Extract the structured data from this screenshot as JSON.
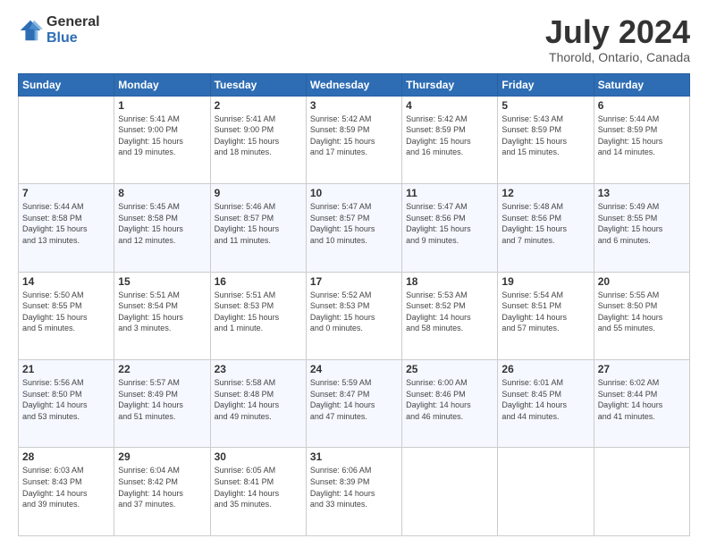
{
  "logo": {
    "general": "General",
    "blue": "Blue"
  },
  "header": {
    "month": "July 2024",
    "location": "Thorold, Ontario, Canada"
  },
  "days_of_week": [
    "Sunday",
    "Monday",
    "Tuesday",
    "Wednesday",
    "Thursday",
    "Friday",
    "Saturday"
  ],
  "weeks": [
    [
      {
        "day": "",
        "info": ""
      },
      {
        "day": "1",
        "info": "Sunrise: 5:41 AM\nSunset: 9:00 PM\nDaylight: 15 hours\nand 19 minutes."
      },
      {
        "day": "2",
        "info": "Sunrise: 5:41 AM\nSunset: 9:00 PM\nDaylight: 15 hours\nand 18 minutes."
      },
      {
        "day": "3",
        "info": "Sunrise: 5:42 AM\nSunset: 8:59 PM\nDaylight: 15 hours\nand 17 minutes."
      },
      {
        "day": "4",
        "info": "Sunrise: 5:42 AM\nSunset: 8:59 PM\nDaylight: 15 hours\nand 16 minutes."
      },
      {
        "day": "5",
        "info": "Sunrise: 5:43 AM\nSunset: 8:59 PM\nDaylight: 15 hours\nand 15 minutes."
      },
      {
        "day": "6",
        "info": "Sunrise: 5:44 AM\nSunset: 8:59 PM\nDaylight: 15 hours\nand 14 minutes."
      }
    ],
    [
      {
        "day": "7",
        "info": "Sunrise: 5:44 AM\nSunset: 8:58 PM\nDaylight: 15 hours\nand 13 minutes."
      },
      {
        "day": "8",
        "info": "Sunrise: 5:45 AM\nSunset: 8:58 PM\nDaylight: 15 hours\nand 12 minutes."
      },
      {
        "day": "9",
        "info": "Sunrise: 5:46 AM\nSunset: 8:57 PM\nDaylight: 15 hours\nand 11 minutes."
      },
      {
        "day": "10",
        "info": "Sunrise: 5:47 AM\nSunset: 8:57 PM\nDaylight: 15 hours\nand 10 minutes."
      },
      {
        "day": "11",
        "info": "Sunrise: 5:47 AM\nSunset: 8:56 PM\nDaylight: 15 hours\nand 9 minutes."
      },
      {
        "day": "12",
        "info": "Sunrise: 5:48 AM\nSunset: 8:56 PM\nDaylight: 15 hours\nand 7 minutes."
      },
      {
        "day": "13",
        "info": "Sunrise: 5:49 AM\nSunset: 8:55 PM\nDaylight: 15 hours\nand 6 minutes."
      }
    ],
    [
      {
        "day": "14",
        "info": "Sunrise: 5:50 AM\nSunset: 8:55 PM\nDaylight: 15 hours\nand 5 minutes."
      },
      {
        "day": "15",
        "info": "Sunrise: 5:51 AM\nSunset: 8:54 PM\nDaylight: 15 hours\nand 3 minutes."
      },
      {
        "day": "16",
        "info": "Sunrise: 5:51 AM\nSunset: 8:53 PM\nDaylight: 15 hours\nand 1 minute."
      },
      {
        "day": "17",
        "info": "Sunrise: 5:52 AM\nSunset: 8:53 PM\nDaylight: 15 hours\nand 0 minutes."
      },
      {
        "day": "18",
        "info": "Sunrise: 5:53 AM\nSunset: 8:52 PM\nDaylight: 14 hours\nand 58 minutes."
      },
      {
        "day": "19",
        "info": "Sunrise: 5:54 AM\nSunset: 8:51 PM\nDaylight: 14 hours\nand 57 minutes."
      },
      {
        "day": "20",
        "info": "Sunrise: 5:55 AM\nSunset: 8:50 PM\nDaylight: 14 hours\nand 55 minutes."
      }
    ],
    [
      {
        "day": "21",
        "info": "Sunrise: 5:56 AM\nSunset: 8:50 PM\nDaylight: 14 hours\nand 53 minutes."
      },
      {
        "day": "22",
        "info": "Sunrise: 5:57 AM\nSunset: 8:49 PM\nDaylight: 14 hours\nand 51 minutes."
      },
      {
        "day": "23",
        "info": "Sunrise: 5:58 AM\nSunset: 8:48 PM\nDaylight: 14 hours\nand 49 minutes."
      },
      {
        "day": "24",
        "info": "Sunrise: 5:59 AM\nSunset: 8:47 PM\nDaylight: 14 hours\nand 47 minutes."
      },
      {
        "day": "25",
        "info": "Sunrise: 6:00 AM\nSunset: 8:46 PM\nDaylight: 14 hours\nand 46 minutes."
      },
      {
        "day": "26",
        "info": "Sunrise: 6:01 AM\nSunset: 8:45 PM\nDaylight: 14 hours\nand 44 minutes."
      },
      {
        "day": "27",
        "info": "Sunrise: 6:02 AM\nSunset: 8:44 PM\nDaylight: 14 hours\nand 41 minutes."
      }
    ],
    [
      {
        "day": "28",
        "info": "Sunrise: 6:03 AM\nSunset: 8:43 PM\nDaylight: 14 hours\nand 39 minutes."
      },
      {
        "day": "29",
        "info": "Sunrise: 6:04 AM\nSunset: 8:42 PM\nDaylight: 14 hours\nand 37 minutes."
      },
      {
        "day": "30",
        "info": "Sunrise: 6:05 AM\nSunset: 8:41 PM\nDaylight: 14 hours\nand 35 minutes."
      },
      {
        "day": "31",
        "info": "Sunrise: 6:06 AM\nSunset: 8:39 PM\nDaylight: 14 hours\nand 33 minutes."
      },
      {
        "day": "",
        "info": ""
      },
      {
        "day": "",
        "info": ""
      },
      {
        "day": "",
        "info": ""
      }
    ]
  ]
}
